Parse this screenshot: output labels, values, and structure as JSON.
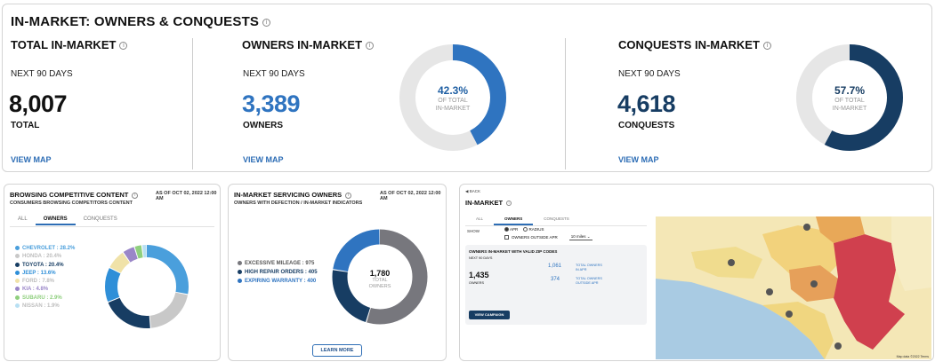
{
  "header": {
    "title": "IN-MARKET: OWNERS & CONQUESTS",
    "info": "i"
  },
  "total": {
    "title": "TOTAL IN-MARKET",
    "period": "NEXT 90 DAYS",
    "value": "8,007",
    "label": "TOTAL",
    "link": "VIEW MAP"
  },
  "owners": {
    "title": "OWNERS IN-MARKET",
    "period": "NEXT 90 DAYS",
    "value": "3,389",
    "label": "OWNERS",
    "link": "VIEW MAP",
    "pct": "42.3%",
    "pct_value": 42.3,
    "cap1": "OF TOTAL",
    "cap2": "IN-MARKET",
    "color": "#2f74c0"
  },
  "conquests": {
    "title": "CONQUESTS IN-MARKET",
    "period": "NEXT 90 DAYS",
    "value": "4,618",
    "label": "CONQUESTS",
    "link": "VIEW MAP",
    "pct": "57.7%",
    "pct_value": 57.7,
    "cap1": "OF TOTAL",
    "cap2": "IN-MARKET",
    "color": "#173d63"
  },
  "browsing": {
    "title": "BROWSING COMPETITIVE CONTENT",
    "asof": "AS OF OCT 02, 2022 12:00 AM",
    "subtitle": "CONSUMERS BROWSING COMPETITORS CONTENT",
    "tabs": [
      "ALL",
      "OWNERS",
      "CONQUESTS"
    ],
    "active_tab": "OWNERS",
    "items": [
      {
        "label": "CHEVROLET : 28.2%",
        "value": 28.2,
        "color": "#4a9fdc"
      },
      {
        "label": "HONDA : 20.4%",
        "value": 20.4,
        "color": "#c8c8c8"
      },
      {
        "label": "TOYOTA : 20.4%",
        "value": 20.4,
        "color": "#173d63"
      },
      {
        "label": "JEEP : 13.6%",
        "value": 13.6,
        "color": "#2f8fd8"
      },
      {
        "label": "FORD : 7.8%",
        "value": 7.8,
        "color": "#f0e2a8"
      },
      {
        "label": "KIA : 4.8%",
        "value": 4.8,
        "color": "#9a86c8"
      },
      {
        "label": "SUBARU : 2.9%",
        "value": 2.9,
        "color": "#8fcf7e"
      },
      {
        "label": "NISSAN : 1.9%",
        "value": 1.9,
        "color": "#b8e0f3"
      }
    ]
  },
  "servicing": {
    "title": "IN-MARKET SERVICING OWNERS",
    "asof": "AS OF OCT 02, 2022 12:00 AM",
    "subtitle": "OWNERS WITH DEFECTION / IN-MARKET INDICATORS",
    "items": [
      {
        "label": "EXCESSIVE MILEAGE : 975",
        "value": 975,
        "color": "#77777d"
      },
      {
        "label": "HIGH REPAIR ORDERS : 405",
        "value": 405,
        "color": "#173d63"
      },
      {
        "label": "EXPIRING WARRANTY : 400",
        "value": 400,
        "color": "#2f74c0"
      }
    ],
    "total": "1,780",
    "total_cap1": "TOTAL",
    "total_cap2": "OWNERS",
    "button": "LEARN MORE"
  },
  "mapcard": {
    "back": "◀ BACK",
    "title": "IN-MARKET",
    "tabs": [
      "ALL",
      "OWNERS",
      "CONQUESTS"
    ],
    "active_tab": "OWNERS",
    "show_label": "SHOW",
    "opt1": "APR",
    "opt2": "RADIUS",
    "checkbox": "OWNERS OUTSIDE APR",
    "select": "10 miles",
    "box_title": "OWNERS IN-MARKET WITH VALID ZIP CODES",
    "box_sub": "NEXT 90 DAYS",
    "owners_value": "1,435",
    "owners_label": "OWNERS",
    "total_owners_value": "1,061",
    "total_owners_label": "TOTAL OWNERS",
    "total_owners_sub": "IN APR",
    "outside_value": "374",
    "outside_label": "TOTAL OWNERS",
    "outside_sub": "OUTSIDE APR",
    "button": "VIEW CAMPAIGN",
    "attribution": "Map data ©2022 Terms"
  }
}
